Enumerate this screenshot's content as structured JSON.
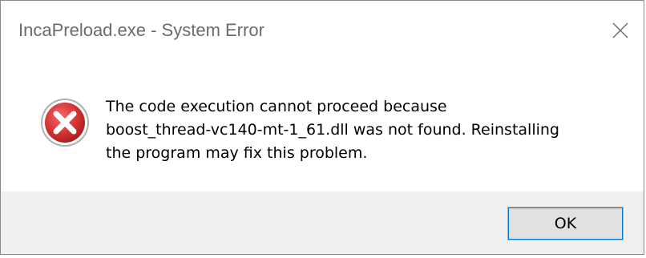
{
  "window": {
    "title": "IncaPreload.exe - System Error",
    "close_icon": "close-icon"
  },
  "message": {
    "icon": "error-icon",
    "lines": [
      "The code execution cannot proceed because",
      "boost_thread-vc140-mt-1_61.dll was not found. Reinstalling",
      "the program may fix this problem."
    ]
  },
  "buttons": {
    "ok_label": "OK"
  },
  "colors": {
    "title_text": "#6b6b6b",
    "footer_bg": "#f0f0f0",
    "button_bg": "#e1e1e1",
    "button_focus": "#0078d7",
    "error_red": "#c6262e"
  }
}
